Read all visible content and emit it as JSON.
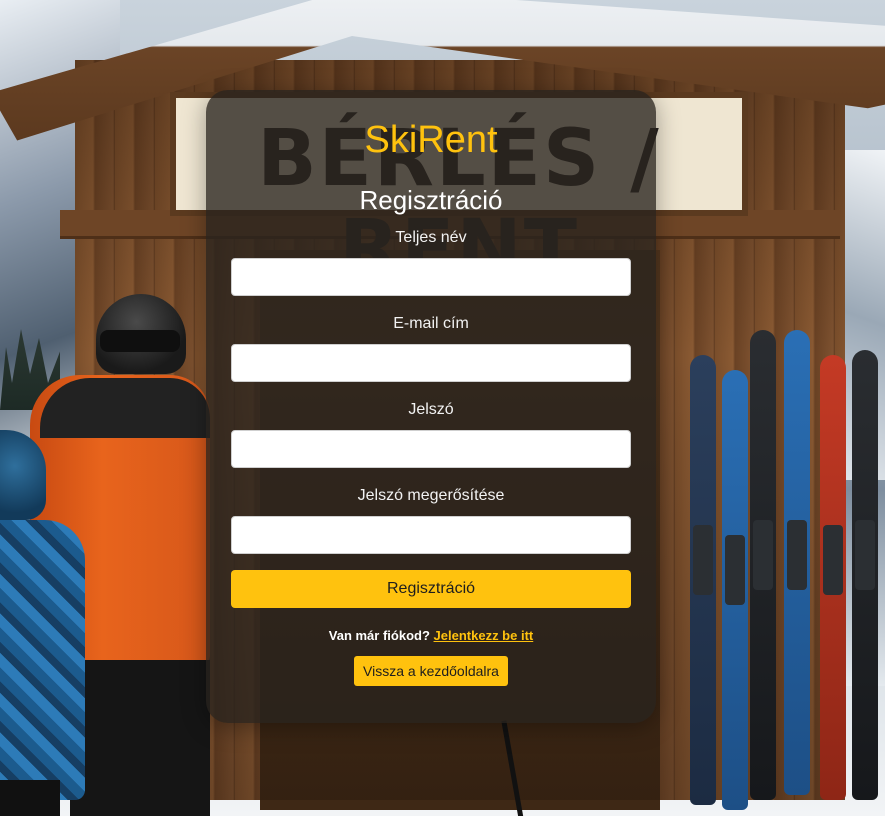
{
  "brand": "SkiRent",
  "background_sign": "BÉRLÉS / RENT",
  "form": {
    "title": "Regisztráció",
    "fields": [
      {
        "label": "Teljes név",
        "value": "",
        "placeholder": ""
      },
      {
        "label": "E-mail cím",
        "value": "",
        "placeholder": ""
      },
      {
        "label": "Jelszó",
        "value": "",
        "placeholder": ""
      },
      {
        "label": "Jelszó megerősítése",
        "value": "",
        "placeholder": ""
      }
    ],
    "submit_label": "Regisztráció"
  },
  "login_prompt": {
    "text": "Van már fiókod?",
    "link_text": "Jelentkezz be itt"
  },
  "home_button_label": "Vissza a kezdőoldalra",
  "colors": {
    "accent": "#ffc20e",
    "card_background": "rgba(40,34,30,0.78)",
    "text_light": "#ffffff"
  }
}
